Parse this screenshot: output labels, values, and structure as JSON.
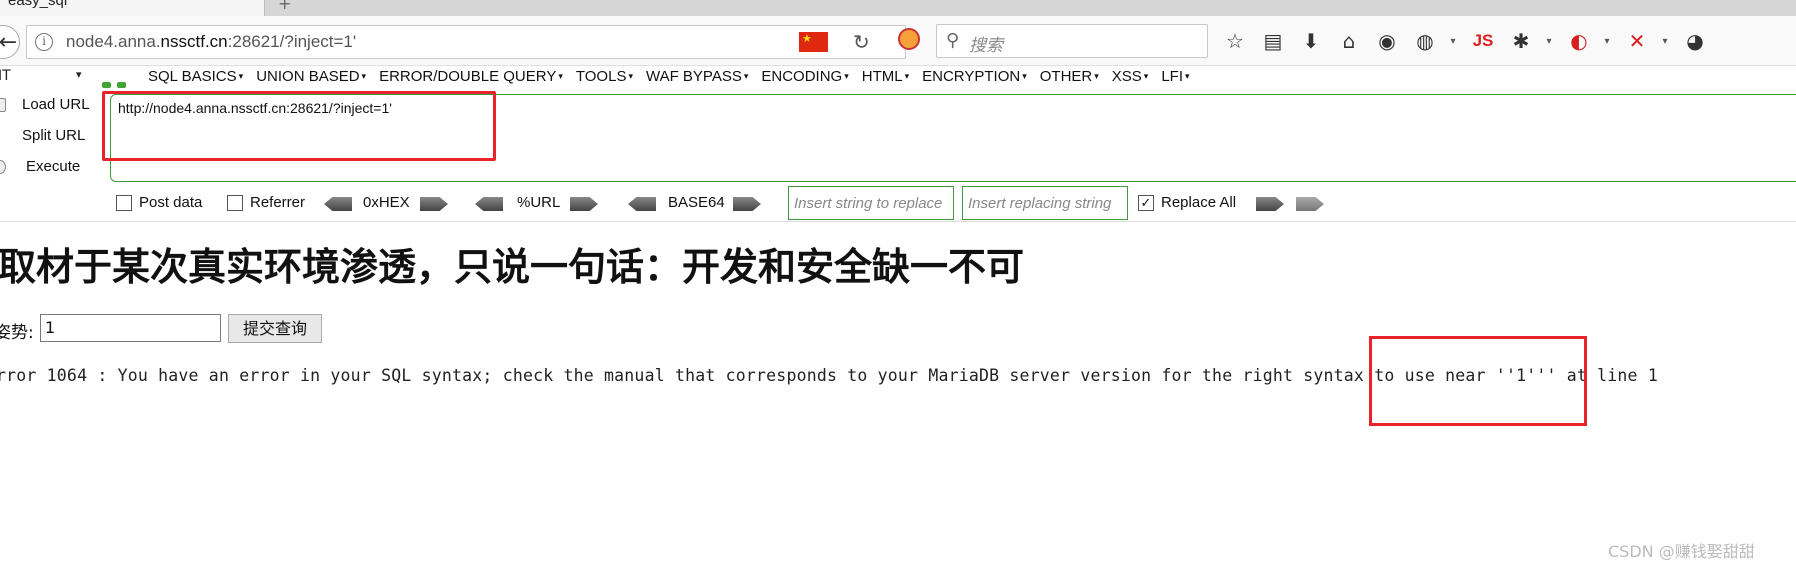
{
  "tab": {
    "title": "easy_sql",
    "new_tab": "+"
  },
  "nav": {
    "url_prefix": "node4.anna.",
    "url_host": "nssctf.cn",
    "url_suffix": ":28621/?inject=1'",
    "search_placeholder": "搜索",
    "js_label": "JS"
  },
  "hackbar": {
    "select_value": "IT",
    "menus": [
      "SQL BASICS",
      "UNION BASED",
      "ERROR/DOUBLE QUERY",
      "TOOLS",
      "WAF BYPASS",
      "ENCODING",
      "HTML",
      "ENCRYPTION",
      "OTHER",
      "XSS",
      "LFI"
    ],
    "actions": {
      "load": "Load URL",
      "split": "Split URL",
      "execute": "Execute"
    },
    "url_value": "http://node4.anna.nssctf.cn:28621/?inject=1'",
    "options": {
      "post_data": "Post data",
      "referrer": "Referrer",
      "hex": "0xHEX",
      "url": "%URL",
      "base64": "BASE64",
      "insert_placeholder": "Insert string to replace",
      "replacing_placeholder": "Insert replacing string",
      "replace_all": "Replace All"
    }
  },
  "page": {
    "heading": "取材于某次真实环境渗透，只说一句话：开发和安全缺一不可",
    "form_label": "姿势:",
    "input_value": "1",
    "submit_label": "提交查询",
    "error": "rror 1064 : You have an error in your SQL syntax; check the manual that corresponds to your MariaDB server version for the right syntax to use near ''1''' at line 1"
  },
  "watermark": "CSDN @赚钱娶甜甜",
  "colors": {
    "highlight": "#e8232a",
    "hackbar_green": "#3e9b3e"
  }
}
